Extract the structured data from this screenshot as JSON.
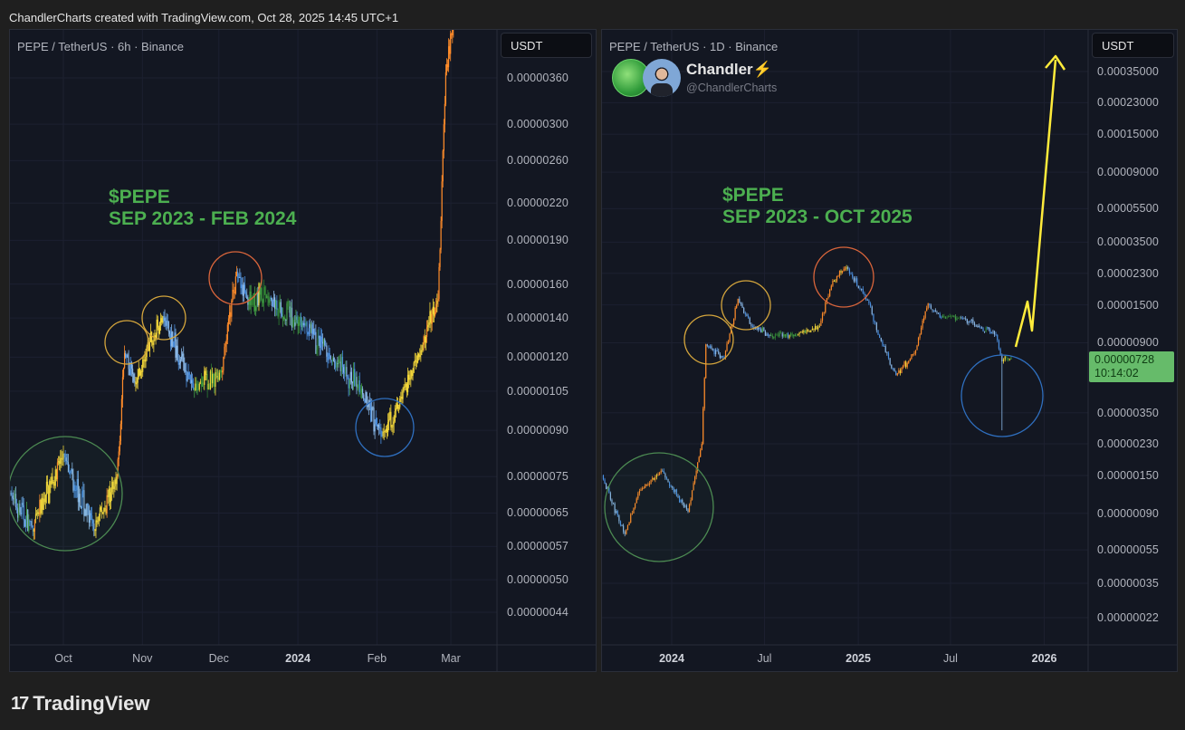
{
  "header": {
    "attribution": "ChandlerCharts created with TradingView.com, Oct 28, 2025 14:45 UTC+1"
  },
  "footer": {
    "logo_text": "TradingView",
    "logo_icon": "tradingview-logo-icon"
  },
  "colors": {
    "background": "#1f1f1f",
    "panel": "#131722",
    "annotation_text": "#4caf50",
    "arrow": "#ffeb3b",
    "last_price_badge": "#66bb6a",
    "candle_up_strong": "#ff8c2a",
    "candle_up": "#f5d83a",
    "candle_flat": "#43a047",
    "candle_down": "#8ab8e8"
  },
  "chart_data": [
    {
      "type": "candlestick",
      "title": "PEPE / TetherUS · 6h · Binance",
      "currency": "USDT",
      "y_scale": "log",
      "grid": true,
      "annotation": {
        "line1": "$PEPE",
        "line2": "SEP 2023 - FEB 2024"
      },
      "y_ticks": [
        "0.00000360",
        "0.00000300",
        "0.00000260",
        "0.00000220",
        "0.00000190",
        "0.00000160",
        "0.00000140",
        "0.00000120",
        "0.00000105",
        "0.00000090",
        "0.00000075",
        "0.00000065",
        "0.00000057",
        "0.00000050",
        "0.00000044"
      ],
      "x_ticks": [
        {
          "label": "Oct",
          "date": "2023-10-01"
        },
        {
          "label": "Nov",
          "date": "2023-11-01"
        },
        {
          "label": "Dec",
          "date": "2023-12-01"
        },
        {
          "label": "2024",
          "date": "2024-01-01",
          "year": true
        },
        {
          "label": "Feb",
          "date": "2024-02-01"
        },
        {
          "label": "Mar",
          "date": "2024-03-01"
        }
      ],
      "series": [
        {
          "date": "2023-09-10",
          "close": 7e-07
        },
        {
          "date": "2023-09-19",
          "close": 6.1e-07
        },
        {
          "date": "2023-10-01",
          "close": 8.2e-07
        },
        {
          "date": "2023-10-13",
          "close": 6.1e-07
        },
        {
          "date": "2023-10-22",
          "close": 7.5e-07
        },
        {
          "date": "2023-10-25",
          "close": 1.22e-06
        },
        {
          "date": "2023-10-29",
          "close": 1.09e-06
        },
        {
          "date": "2023-11-09",
          "close": 1.41e-06
        },
        {
          "date": "2023-11-21",
          "close": 1.06e-06
        },
        {
          "date": "2023-12-02",
          "close": 1.13e-06
        },
        {
          "date": "2023-12-08",
          "close": 1.68e-06
        },
        {
          "date": "2023-12-12",
          "close": 1.51e-06
        },
        {
          "date": "2023-12-21",
          "close": 1.51e-06
        },
        {
          "date": "2024-01-03",
          "close": 1.36e-06
        },
        {
          "date": "2024-01-15",
          "close": 1.18e-06
        },
        {
          "date": "2024-01-26",
          "close": 1.06e-06
        },
        {
          "date": "2024-02-03",
          "close": 8.8e-07
        },
        {
          "date": "2024-02-10",
          "close": 1.02e-06
        },
        {
          "date": "2024-02-19",
          "close": 1.26e-06
        },
        {
          "date": "2024-02-25",
          "close": 1.51e-06
        },
        {
          "date": "2024-02-28",
          "close": 3.68e-06
        },
        {
          "date": "2024-03-02",
          "close": 4.4e-06
        }
      ]
    },
    {
      "type": "candlestick",
      "title": "PEPE / TetherUS · 1D · Binance",
      "currency": "USDT",
      "y_scale": "log",
      "grid": true,
      "author": {
        "name": "Chandler⚡",
        "handle": "@ChandlerCharts"
      },
      "annotation": {
        "line1": "$PEPE",
        "line2": "SEP 2023 - OCT 2025"
      },
      "last_price": {
        "value": "0.00000728",
        "countdown": "10:14:02"
      },
      "y_ticks": [
        "0.00035000",
        "0.00023000",
        "0.00015000",
        "0.00009000",
        "0.00005500",
        "0.00003500",
        "0.00002300",
        "0.00001500",
        "0.00000900",
        "0.00000350",
        "0.00000230",
        "0.00000150",
        "0.00000090",
        "0.00000055",
        "0.00000035",
        "0.00000022"
      ],
      "x_ticks": [
        {
          "label": "2024",
          "date": "2024-01-01",
          "year": true
        },
        {
          "label": "Jul",
          "date": "2024-07-01"
        },
        {
          "label": "2025",
          "date": "2025-01-01",
          "year": true
        },
        {
          "label": "Jul",
          "date": "2025-07-01"
        },
        {
          "label": "2026",
          "date": "2026-01-01",
          "year": true
        }
      ],
      "series": [
        {
          "date": "2023-08-17",
          "close": 1.5e-06
        },
        {
          "date": "2023-10-01",
          "close": 6.8e-07
        },
        {
          "date": "2023-10-27",
          "close": 1.18e-06
        },
        {
          "date": "2023-12-11",
          "close": 1.6e-06
        },
        {
          "date": "2024-02-02",
          "close": 9.2e-07
        },
        {
          "date": "2024-02-29",
          "close": 2.3e-06
        },
        {
          "date": "2024-03-08",
          "close": 8.8e-06
        },
        {
          "date": "2024-04-13",
          "close": 7.4e-06
        },
        {
          "date": "2024-05-10",
          "close": 1.63e-05
        },
        {
          "date": "2024-06-05",
          "close": 1.13e-05
        },
        {
          "date": "2024-07-11",
          "close": 1e-05
        },
        {
          "date": "2024-09-02",
          "close": 1e-05
        },
        {
          "date": "2024-10-17",
          "close": 1.13e-05
        },
        {
          "date": "2024-11-12",
          "close": 2.08e-05
        },
        {
          "date": "2024-12-09",
          "close": 2.5e-05
        },
        {
          "date": "2025-01-22",
          "close": 1.53e-05
        },
        {
          "date": "2025-02-09",
          "close": 1e-05
        },
        {
          "date": "2025-03-16",
          "close": 5.8e-06
        },
        {
          "date": "2025-04-21",
          "close": 7.8e-06
        },
        {
          "date": "2025-05-18",
          "close": 1.53e-05
        },
        {
          "date": "2025-06-13",
          "close": 1.27e-05
        },
        {
          "date": "2025-07-19",
          "close": 1.27e-05
        },
        {
          "date": "2025-08-23",
          "close": 1.13e-05
        },
        {
          "date": "2025-09-28",
          "close": 1e-05
        },
        {
          "date": "2025-10-10",
          "close": 7e-06,
          "low": 2.76e-06
        },
        {
          "date": "2025-10-28",
          "close": 7.28e-06
        }
      ]
    }
  ]
}
